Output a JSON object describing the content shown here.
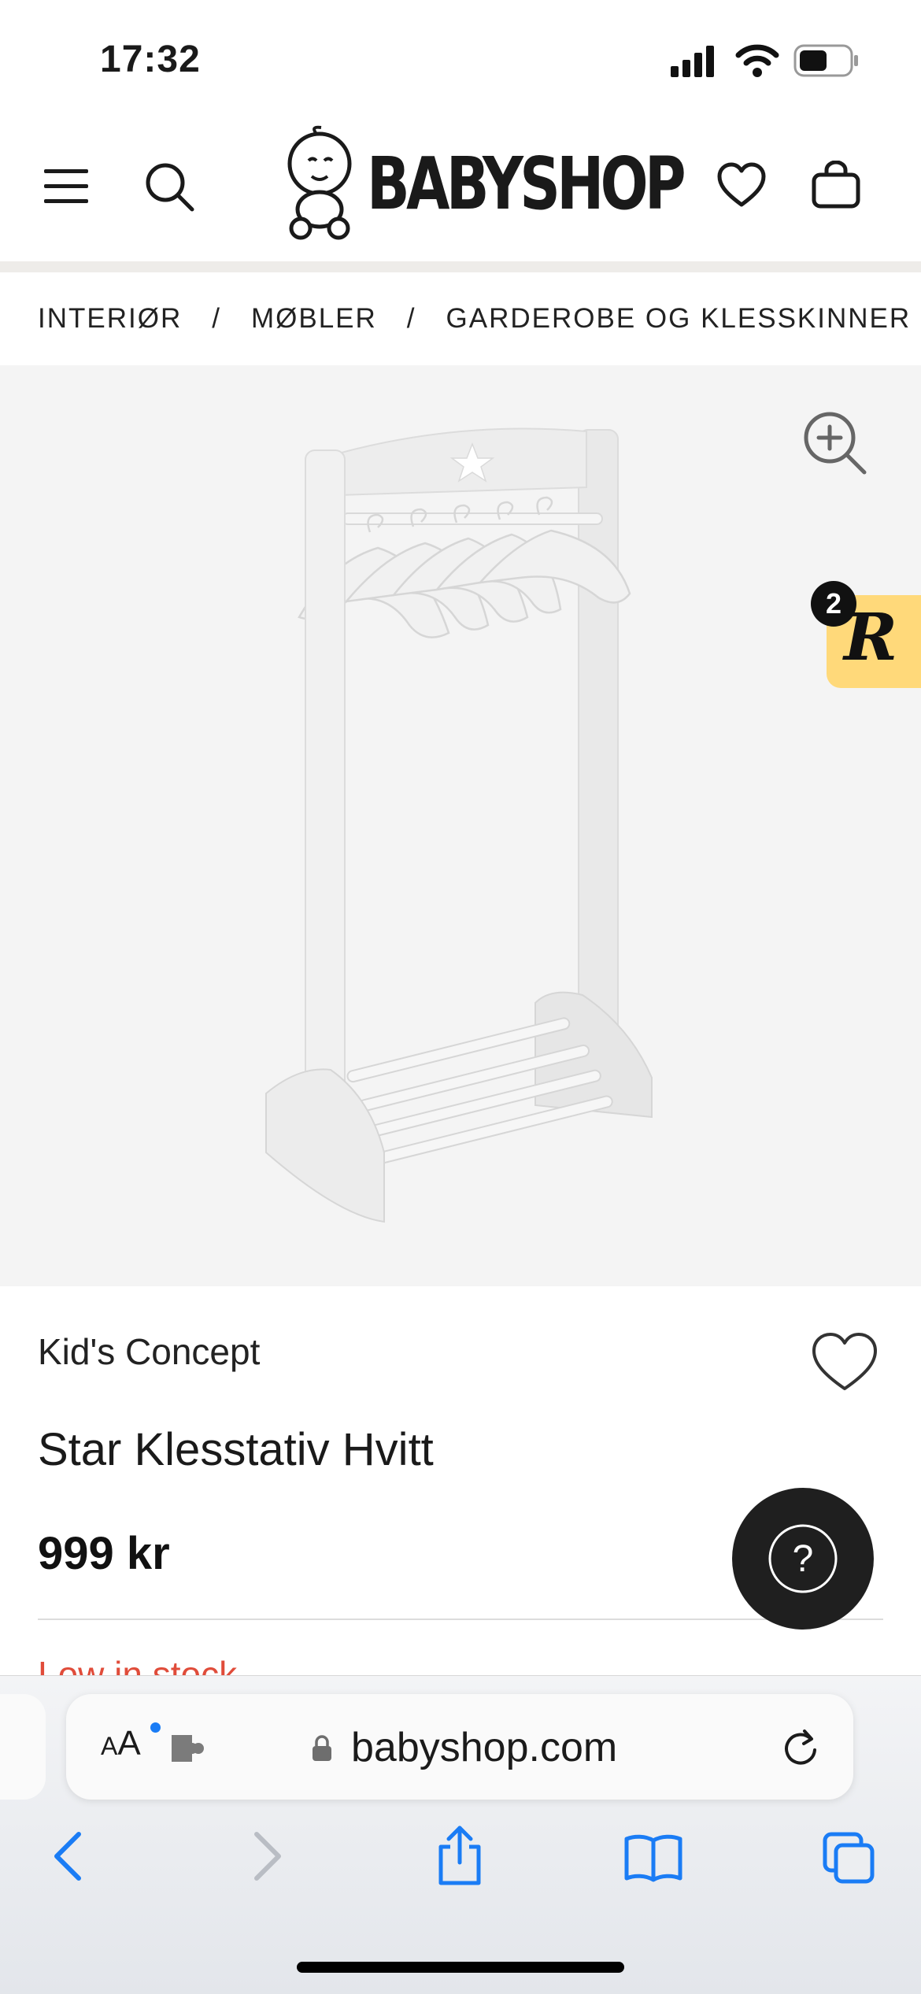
{
  "status_bar": {
    "time": "17:32"
  },
  "header": {
    "logo_text": "BABYSHOP"
  },
  "breadcrumb": {
    "items": [
      "INTERIØR",
      "MØBLER",
      "GARDEROBE OG KLESSKINNER"
    ],
    "separator": "/"
  },
  "product": {
    "brand": "Kid's Concept",
    "title": "Star Klesstativ Hvitt",
    "price": "999 kr",
    "stock_status": "Low in stock"
  },
  "rewards_widget": {
    "badge_count": "2",
    "letter": "R"
  },
  "help_button": {
    "label": "?"
  },
  "browser": {
    "text_size_label_small": "A",
    "text_size_label_large": "A",
    "url": "babyshop.com"
  },
  "colors": {
    "accent_yellow": "#ffd97a",
    "stock_red": "#e04c3a",
    "safari_blue": "#1a7cf5",
    "help_button_bg": "#1f1f1f"
  }
}
